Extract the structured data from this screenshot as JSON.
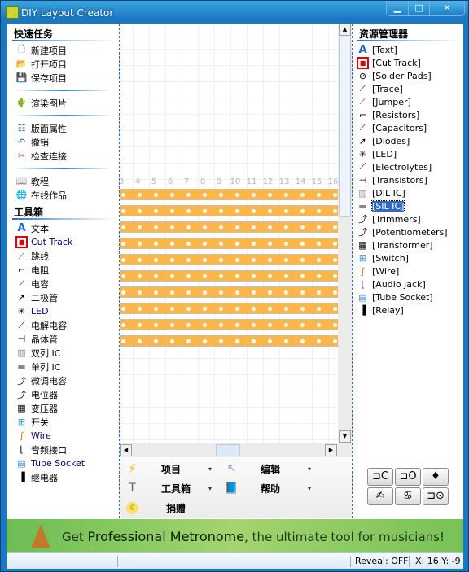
{
  "window": {
    "title": "DIY Layout Creator",
    "buttons": {
      "minimize": "▁",
      "maximize": "□",
      "close": "✕"
    }
  },
  "left_panel": {
    "quick_tasks_title": "快速任务",
    "quick_tasks": [
      {
        "label": "新建项目",
        "icon": "new-document-icon"
      },
      {
        "label": "打开项目",
        "icon": "open-folder-icon"
      },
      {
        "label": "保存项目",
        "icon": "save-disk-icon"
      }
    ],
    "render_tasks": [
      {
        "label": "渲染图片",
        "icon": "render-image-icon"
      }
    ],
    "edit_tasks": [
      {
        "label": "版面属性",
        "icon": "properties-icon"
      },
      {
        "label": "撤销",
        "icon": "undo-icon"
      },
      {
        "label": "检查连接",
        "icon": "check-connections-icon"
      }
    ],
    "help_tasks": [
      {
        "label": "教程",
        "icon": "tutorial-book-icon"
      },
      {
        "label": "在线作品",
        "icon": "globe-icon"
      }
    ],
    "toolbox_title": "工具箱",
    "toolbox": [
      {
        "label": "文本",
        "icon": "text-icon",
        "en": false
      },
      {
        "label": "Cut Track",
        "icon": "cut-track-icon",
        "en": true
      },
      {
        "label": "跳线",
        "icon": "jumper-icon",
        "en": false
      },
      {
        "label": "电阻",
        "icon": "resistor-icon",
        "en": false
      },
      {
        "label": "电容",
        "icon": "capacitor-icon",
        "en": false
      },
      {
        "label": "二极管",
        "icon": "diode-icon",
        "en": false
      },
      {
        "label": "LED",
        "icon": "led-icon",
        "en": true
      },
      {
        "label": "电解电容",
        "icon": "electrolytic-icon",
        "en": false
      },
      {
        "label": "晶体管",
        "icon": "transistor-icon",
        "en": false
      },
      {
        "label": "双列 IC",
        "icon": "dil-ic-icon",
        "en": false
      },
      {
        "label": "单列 IC",
        "icon": "sil-ic-icon",
        "en": false
      },
      {
        "label": "微调电容",
        "icon": "trimmer-icon",
        "en": false
      },
      {
        "label": "电位器",
        "icon": "potentiometer-icon",
        "en": false
      },
      {
        "label": "变压器",
        "icon": "transformer-icon",
        "en": false
      },
      {
        "label": "开关",
        "icon": "switch-icon",
        "en": false
      },
      {
        "label": "Wire",
        "icon": "wire-icon",
        "en": true
      },
      {
        "label": "音频接口",
        "icon": "audio-jack-icon",
        "en": false
      },
      {
        "label": "Tube Socket",
        "icon": "tube-socket-icon",
        "en": true
      },
      {
        "label": "继电器",
        "icon": "relay-icon",
        "en": false
      }
    ]
  },
  "canvas": {
    "ruler_numbers": [
      "3",
      "4",
      "5",
      "6",
      "7",
      "8",
      "9",
      "10",
      "11",
      "12",
      "13",
      "14",
      "15",
      "16"
    ],
    "strip_count": 10,
    "strip_color": "#fcb748",
    "holes_per_strip": 14
  },
  "bottom_menu": {
    "project": "项目",
    "edit": "编辑",
    "toolbox": "工具箱",
    "help": "帮助",
    "donate": "捐赠",
    "dropdown_arrow": "▾"
  },
  "right_panel": {
    "title": "资源管理器",
    "items": [
      {
        "label": "[Text]",
        "icon": "text-icon"
      },
      {
        "label": "[Cut Track]",
        "icon": "cut-track-icon"
      },
      {
        "label": "[Solder Pads]",
        "icon": "solder-pad-icon"
      },
      {
        "label": "[Trace]",
        "icon": "trace-icon"
      },
      {
        "label": "[Jumper]",
        "icon": "jumper-icon"
      },
      {
        "label": "[Resistors]",
        "icon": "resistor-icon"
      },
      {
        "label": "[Capacitors]",
        "icon": "capacitor-icon"
      },
      {
        "label": "[Diodes]",
        "icon": "diode-icon"
      },
      {
        "label": "[LED]",
        "icon": "led-icon"
      },
      {
        "label": "[Electrolytes]",
        "icon": "electrolytic-icon"
      },
      {
        "label": "[Transistors]",
        "icon": "transistor-icon"
      },
      {
        "label": "[DIL IC]",
        "icon": "dil-ic-icon"
      },
      {
        "label": "[SIL IC]",
        "icon": "sil-ic-icon",
        "selected": true
      },
      {
        "label": "[Trimmers]",
        "icon": "trimmer-icon"
      },
      {
        "label": "[Potentiometers]",
        "icon": "potentiometer-icon"
      },
      {
        "label": "[Transformer]",
        "icon": "transformer-icon"
      },
      {
        "label": "[Switch]",
        "icon": "switch-icon"
      },
      {
        "label": "[Wire]",
        "icon": "wire-icon"
      },
      {
        "label": "[Audio Jack]",
        "icon": "audio-jack-icon"
      },
      {
        "label": "[Tube Socket]",
        "icon": "tube-socket-icon"
      },
      {
        "label": "[Relay]",
        "icon": "relay-icon"
      }
    ],
    "tool_buttons": [
      "⊐C",
      "⊐O",
      "♦",
      "✍",
      "♋",
      "⊐⊙"
    ]
  },
  "banner": {
    "pre": "Get ",
    "bold": "Professional Metronome",
    "post": ", the ultimate tool for musicians!"
  },
  "status": {
    "reveal": "Reveal: OFF",
    "coords": "X: 16 Y: -9"
  },
  "colors": {
    "accent": "#316ac5",
    "strip": "#fcb748",
    "banner_green": "#8fcb62"
  }
}
